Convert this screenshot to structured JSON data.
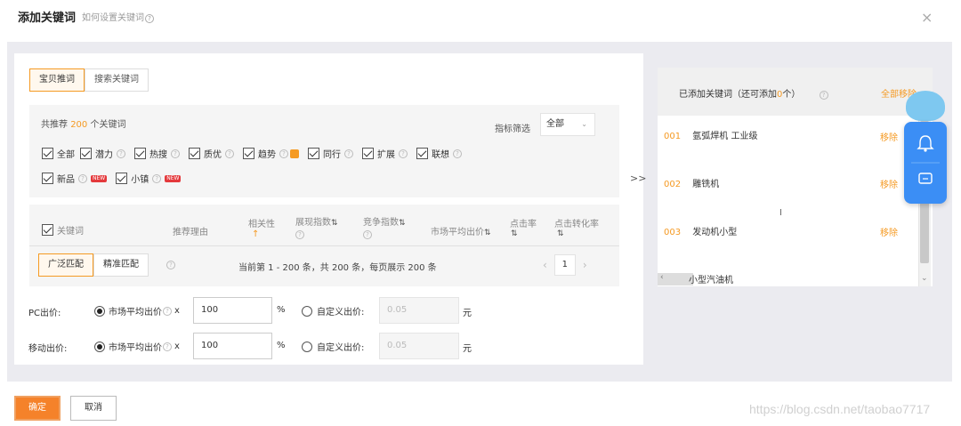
{
  "dialog": {
    "title": "添加关键词",
    "help_link": "如何设置关键词",
    "close_icon": "×"
  },
  "tabs": [
    {
      "label": "宝贝推词",
      "active": true
    },
    {
      "label": "搜索关键词",
      "active": false
    }
  ],
  "recommend": {
    "prefix": "共推荐",
    "count": "200",
    "suffix": "个关键词",
    "filter_label": "指标筛选",
    "filter_value": "全部"
  },
  "checkbox_row1": [
    {
      "label": "全部",
      "help": false
    },
    {
      "label": "潜力",
      "help": true
    },
    {
      "label": "热搜",
      "help": true
    },
    {
      "label": "质优",
      "help": true
    },
    {
      "label": "趋势",
      "help": true,
      "note": true
    },
    {
      "label": "同行",
      "help": true
    },
    {
      "label": "扩展",
      "help": true
    },
    {
      "label": "联想",
      "help": true
    }
  ],
  "checkbox_row2": [
    {
      "label": "新品",
      "badge": "NEW"
    },
    {
      "label": "小镇",
      "badge": "NEW"
    }
  ],
  "table": {
    "col_keyword": "关键词",
    "col_reason": "推荐理由",
    "col_relevance": "相关性",
    "col_impressions": "展现指数",
    "col_competition": "竞争指数",
    "col_avg_bid": "市场平均出价",
    "col_ctr": "点击率",
    "col_cvr": "点击转化率",
    "sort_symbol": "⇅",
    "relevance_arrow": "↑"
  },
  "match": {
    "broad": "广泛匹配",
    "exact": "精准匹配",
    "page_info": "当前第 1 - 200 条，共 200 条，每页展示 200 条",
    "current_page": "1",
    "prev": "‹",
    "next": "›"
  },
  "pc_bid": {
    "label": "PC出价:",
    "market_option": "市场平均出价",
    "x": "x",
    "percent_value": "100",
    "percent": "%",
    "custom_option": "自定义出价:",
    "custom_placeholder": "0.05",
    "currency": "元"
  },
  "mobile_bid": {
    "label": "移动出价:",
    "market_option": "市场平均出价",
    "x": "x",
    "percent_value": "100",
    "percent": "%",
    "custom_option": "自定义出价:",
    "custom_placeholder": "0.05",
    "currency": "元"
  },
  "transfer_arrow": ">>",
  "added": {
    "title_prefix": "已添加关键词（还可添加",
    "remaining": "0",
    "title_suffix": "个）",
    "remove_all": "全部移除",
    "items": [
      {
        "num": "001",
        "keyword": "氩弧焊机 工业级",
        "remove": "移除"
      },
      {
        "num": "002",
        "keyword": "雕铣机",
        "remove": "移除"
      },
      {
        "num": "003",
        "keyword": "发动机小型",
        "remove": "移除"
      },
      {
        "num": "",
        "keyword": "小型汽油机",
        "remove": ""
      }
    ]
  },
  "buttons": {
    "ok": "确定",
    "cancel": "取消"
  },
  "watermark": "https://blog.csdn.net/taobao7717",
  "colors": {
    "accent": "#f59a23",
    "ok_button": "#f5822a",
    "float_bar": "#3b8ef5"
  }
}
